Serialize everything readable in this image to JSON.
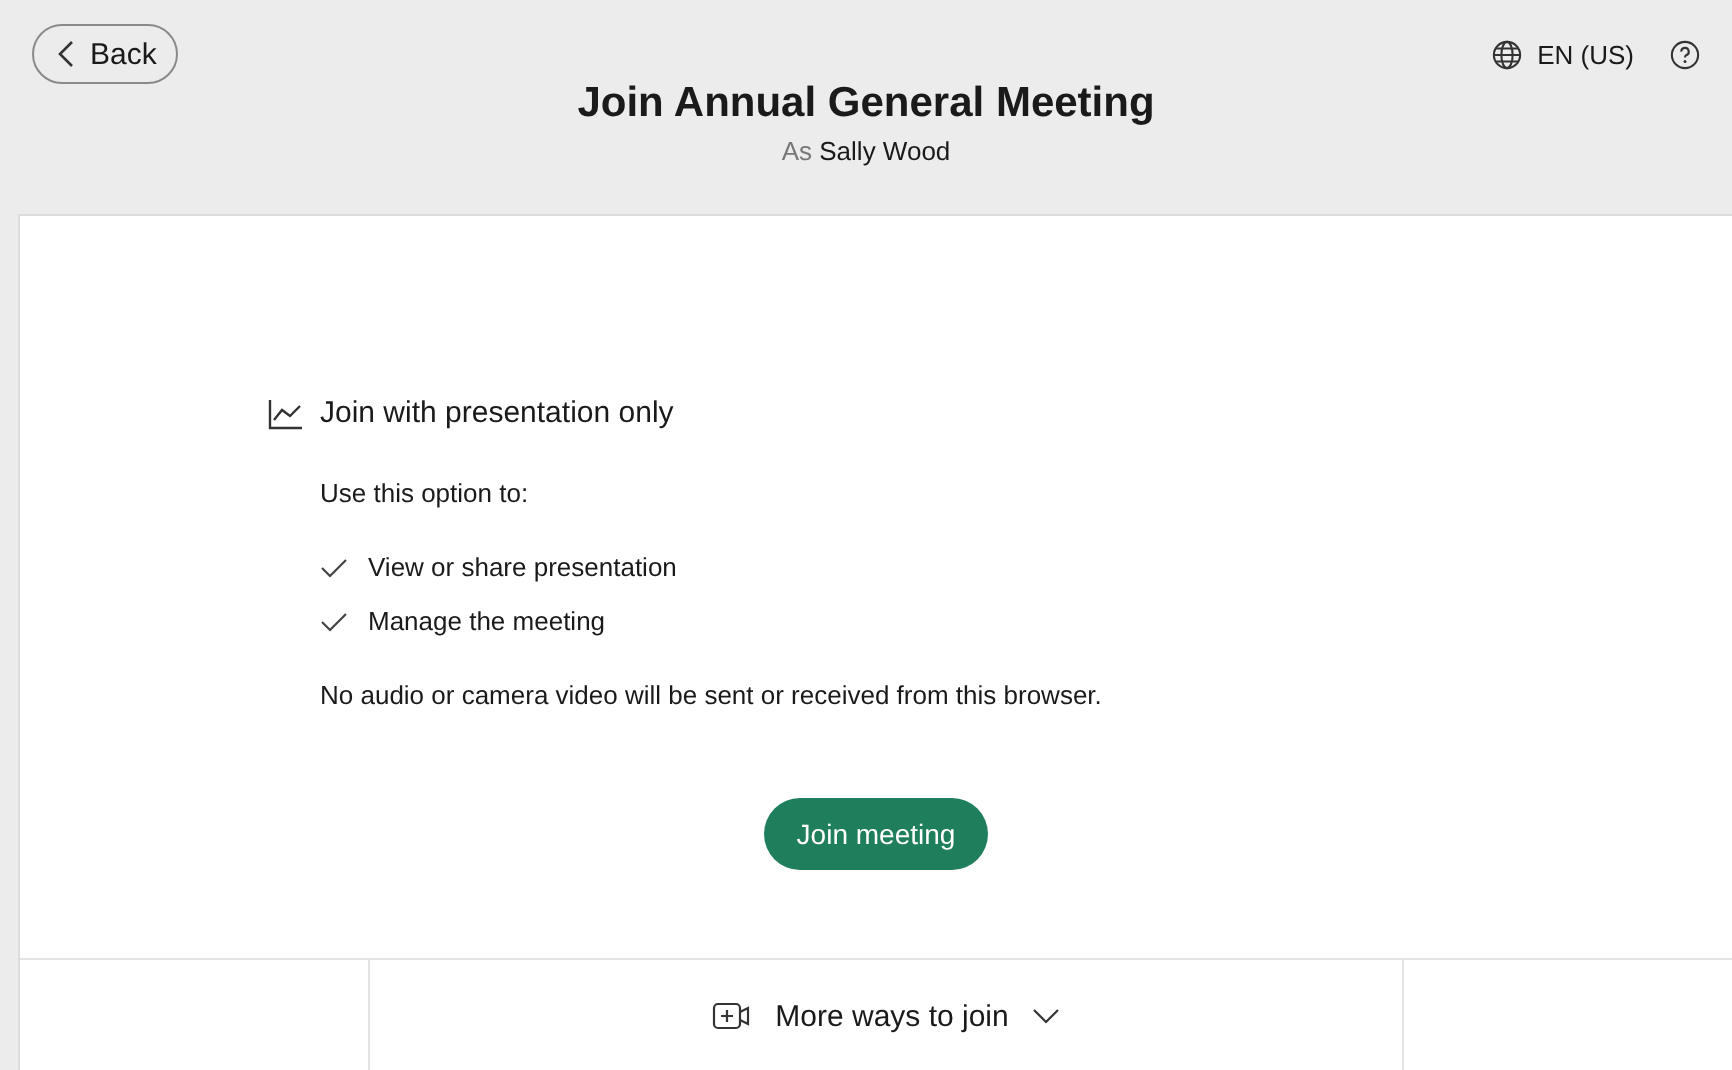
{
  "header": {
    "back_button": "Back",
    "language": "EN (US)",
    "title": "Join Annual General Meeting",
    "as_label": "As",
    "user_name": "Sally Wood"
  },
  "option": {
    "title": "Join with presentation only",
    "intro": "Use this option to:",
    "benefits": [
      "View or share presentation",
      "Manage the meeting"
    ],
    "note": "No audio or camera video will be sent or received from this browser.",
    "button": "Join meeting"
  },
  "footer": {
    "more_ways": "More ways to join",
    "expanded": false
  }
}
